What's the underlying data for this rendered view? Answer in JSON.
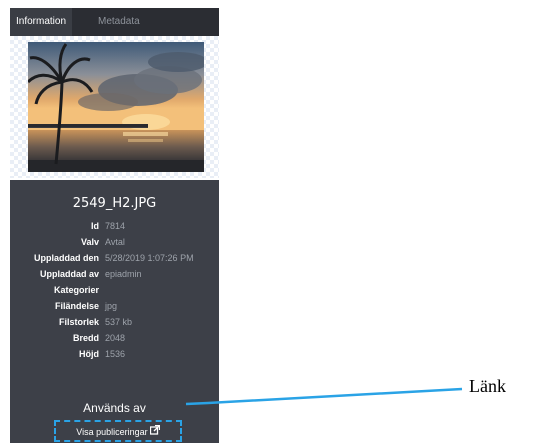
{
  "tabs": [
    {
      "label": "Information",
      "active": true
    },
    {
      "label": "Metadata",
      "active": false
    }
  ],
  "thumbnail": {
    "description_icon": "photo-sunset-palm-icon"
  },
  "file": {
    "name": "2549_H2.JPG",
    "fields": [
      {
        "label": "Id",
        "value": "7814"
      },
      {
        "label": "Valv",
        "value": "Avtal"
      },
      {
        "label": "Uppladdad den",
        "value": "5/28/2019 1:07:26 PM"
      },
      {
        "label": "Uppladdad av",
        "value": "epiadmin"
      },
      {
        "label": "Kategorier",
        "value": ""
      },
      {
        "label": "Filändelse",
        "value": "jpg"
      },
      {
        "label": "Filstorlek",
        "value": "537 kb"
      },
      {
        "label": "Bredd",
        "value": "2048"
      },
      {
        "label": "Höjd",
        "value": "1536"
      }
    ]
  },
  "used_by": {
    "title": "Används av",
    "link_label": "Visa publiceringar",
    "link_icon": "external-link-icon"
  },
  "annotation": {
    "label": "Länk",
    "color": "#2aa3e6"
  },
  "colors": {
    "panel_bg": "#3d4048",
    "tabbar_bg": "#2b2d33",
    "accent": "#2aa3e6"
  }
}
